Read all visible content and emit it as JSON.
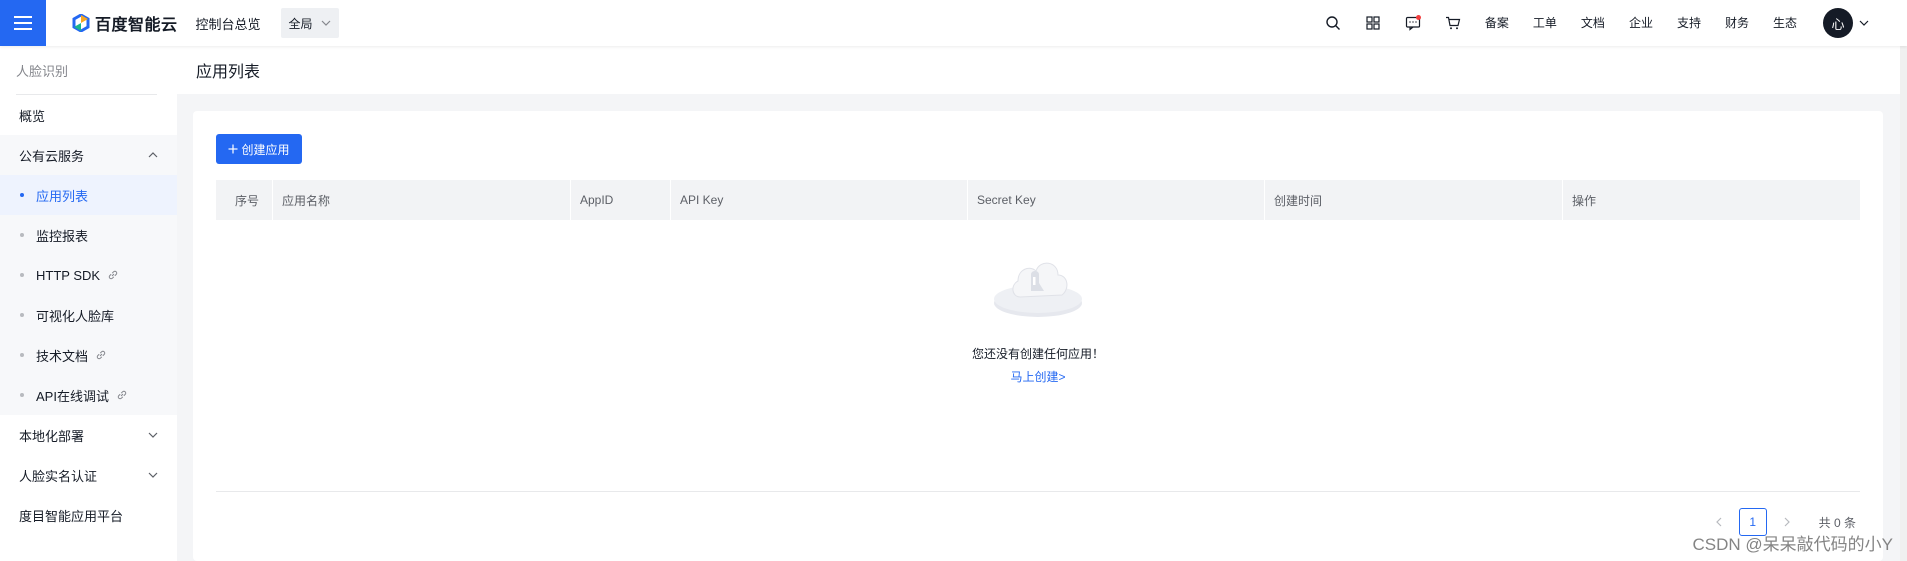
{
  "header": {
    "brand": "百度智能云",
    "console_link": "控制台总览",
    "region": "全局",
    "links": [
      "备案",
      "工单",
      "文档",
      "企业",
      "支持",
      "财务",
      "生态"
    ],
    "avatar_text": "心",
    "icons": [
      "search-icon",
      "grid-icon",
      "message-icon",
      "cart-icon"
    ]
  },
  "sidebar": {
    "product": "人脸识别",
    "overview": "概览",
    "public_cloud": "公有云服务",
    "sub_items": [
      "应用列表",
      "监控报表",
      "HTTP SDK",
      "可视化人脸库",
      "技术文档",
      "API在线调试"
    ],
    "active_sub": "应用列表",
    "local_deploy": "本地化部署",
    "realname": "人脸实名认证",
    "platform": "度目智能应用平台"
  },
  "page": {
    "title": "应用列表",
    "create_button": "创建应用",
    "create_icon": "plus-icon"
  },
  "table": {
    "columns": [
      "序号",
      "应用名称",
      "AppID",
      "API Key",
      "Secret Key",
      "创建时间",
      "操作"
    ],
    "rows": []
  },
  "empty": {
    "message": "您还没有创建任何应用！",
    "link": "马上创建>",
    "illustration": "empty-cloud-illustration"
  },
  "pagination": {
    "current_page": "1",
    "total": "共 0 条"
  },
  "watermark": "CSDN @呆呆敲代码的小Y",
  "colors": {
    "primary": "#2468f2",
    "text": "#151b26",
    "muted": "#84868c",
    "background": "#f4f5f7",
    "notification_dot": "#f33e3e"
  }
}
